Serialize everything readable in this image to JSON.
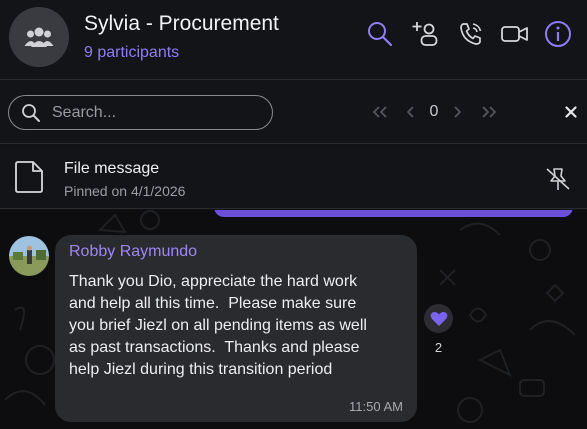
{
  "header": {
    "title": "Sylvia - Procurement",
    "participants": "9 participants",
    "avatar_icon": "group-icon",
    "actions": [
      "search-icon",
      "add-participant-icon",
      "voice-call-icon",
      "video-call-icon",
      "info-icon"
    ],
    "accent_color": "#8f7cf7"
  },
  "search": {
    "placeholder": "Search...",
    "value": "",
    "result_count": "0"
  },
  "pinned": {
    "title": "File message",
    "date": "Pinned on 4/1/2026"
  },
  "message": {
    "sender": "Robby Raymundo",
    "text": "Thank you Dio, appreciate the hard work\nand help all this time.  Please make sure\nyou brief Jiezl on all pending items as well\nas past transactions.  Thanks and please\nhelp Jiezl during this transition period",
    "time": "11:50 AM",
    "reaction_icon": "heart-icon",
    "reaction_count": "2"
  },
  "colors": {
    "bubble": "#2a2b2e",
    "own_bubble": "#6b4fd8",
    "background": "#0d0d0f"
  }
}
